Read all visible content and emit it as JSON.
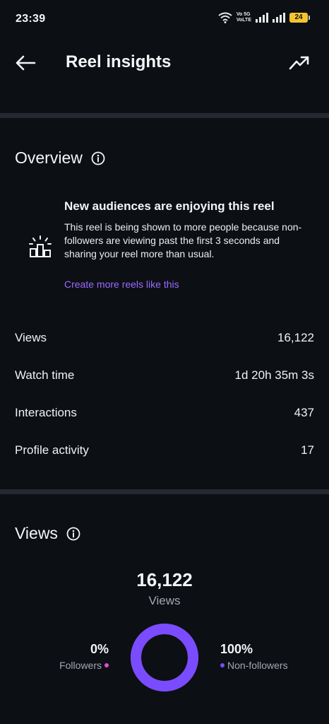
{
  "status_bar": {
    "time": "23:39",
    "network_label_1": "Vo 5G",
    "network_label_2": "VoLTE",
    "battery": "24"
  },
  "header": {
    "title": "Reel insights",
    "back_icon": "arrow-left",
    "trend_icon": "trending-up"
  },
  "overview": {
    "title": "Overview",
    "insight_title": "New audiences are enjoying this reel",
    "insight_description": "This reel is being shown to more people because non-followers are viewing past the first 3 seconds and sharing your reel more than usual.",
    "insight_link": "Create more reels like this",
    "metrics": [
      {
        "label": "Views",
        "value": "16,122"
      },
      {
        "label": "Watch time",
        "value": "1d 20h 35m 3s"
      },
      {
        "label": "Interactions",
        "value": "437"
      },
      {
        "label": "Profile activity",
        "value": "17"
      }
    ]
  },
  "views": {
    "title": "Views",
    "total": "16,122",
    "total_label": "Views",
    "followers_pct": "0%",
    "followers_label": "Followers",
    "followers_fraction": 0,
    "non_followers_pct": "100%",
    "non_followers_label": "Non-followers",
    "non_followers_fraction": 1
  },
  "colors": {
    "accent_link": "#9b6bff",
    "donut": "#7a4cff",
    "followers_dot": "#e84bd0",
    "non_followers_dot": "#7a4cff"
  }
}
